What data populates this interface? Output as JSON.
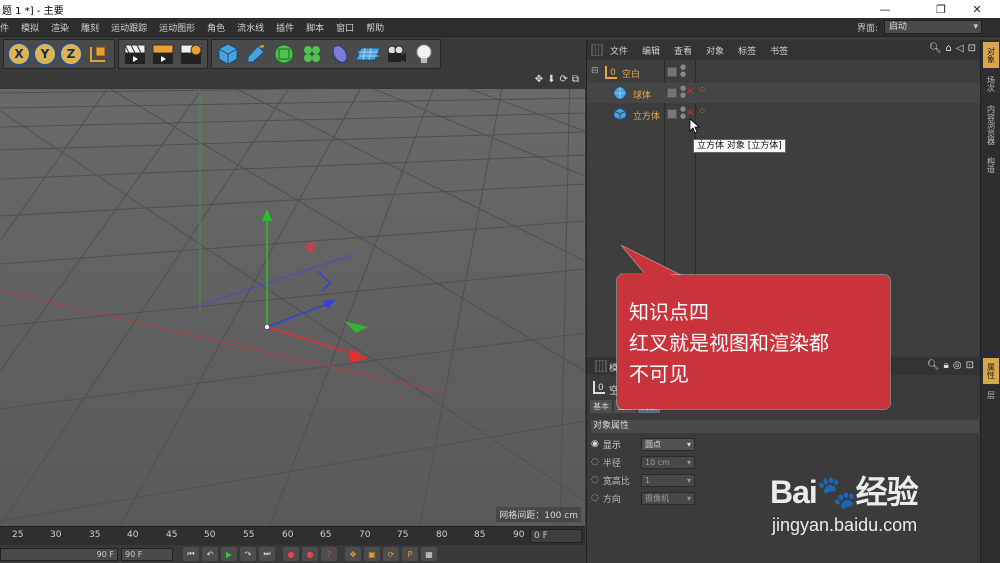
{
  "window": {
    "title": "题 1 *] - 主要",
    "controls": [
      "—",
      "❐",
      "✕"
    ]
  },
  "menubar": {
    "items": [
      "件",
      "模拟",
      "渲染",
      "雕刻",
      "运动跟踪",
      "运动图形",
      "角色",
      "流水线",
      "插件",
      "脚本",
      "窗口",
      "帮助"
    ],
    "layout_label": "界面:",
    "layout_value": "启动"
  },
  "toolbar": {
    "axis_buttons": [
      "X",
      "Y",
      "Z"
    ],
    "icons": [
      "coordinate-system-icon",
      "render-view-icon",
      "render-picture-viewer-icon",
      "render-settings-icon",
      "cube-object-icon",
      "spline-pen-icon",
      "subdivision-icon",
      "cloner-icon",
      "deformer-icon",
      "floor-icon",
      "camera-icon",
      "light-icon"
    ]
  },
  "viewport": {
    "grid_spacing": "网格间距：100 cm",
    "nav_icons": [
      "✥",
      "⬇",
      "⟳",
      "⧉"
    ]
  },
  "timeline": {
    "ticks": [
      "25",
      "30",
      "35",
      "40",
      "45",
      "50",
      "55",
      "60",
      "65",
      "70",
      "75",
      "80",
      "85",
      "90"
    ],
    "current_frame": "0 F",
    "start_field": "90 F",
    "end_field": "90 F"
  },
  "object_manager": {
    "menu": [
      "文件",
      "编辑",
      "查看",
      "对象",
      "标签",
      "书签"
    ],
    "objects": [
      {
        "name": "空白",
        "type": "null",
        "color": "#e8a54a"
      },
      {
        "name": "球体",
        "type": "sphere",
        "color": "#e8a54a"
      },
      {
        "name": "立方体",
        "type": "cube",
        "color": "#e8a54a"
      }
    ],
    "tooltip": "立方体 对象 [立方体]"
  },
  "right_tabs": [
    "对象",
    "场次",
    "内容浏览器",
    "构造",
    "属性",
    "层"
  ],
  "attribute_manager": {
    "header": "模式",
    "object_label": "空白",
    "tabs": [
      "基本",
      "坐标",
      "对象"
    ],
    "section": "对象属性",
    "rows": [
      {
        "label": "显示",
        "value": "圆点",
        "active": true
      },
      {
        "label": "半径",
        "value": "10 cm",
        "active": false
      },
      {
        "label": "宽高比",
        "value": "1",
        "active": false
      },
      {
        "label": "方向",
        "value": "摄像机",
        "active": false
      }
    ]
  },
  "callout": {
    "line1": "知识点四",
    "line2": "红叉就是视图和渲染都",
    "line3": "不可见",
    "color": "#c9343c"
  },
  "watermark": {
    "brand": "Bai🐾经验",
    "url": "jingyan.baidu.com"
  }
}
